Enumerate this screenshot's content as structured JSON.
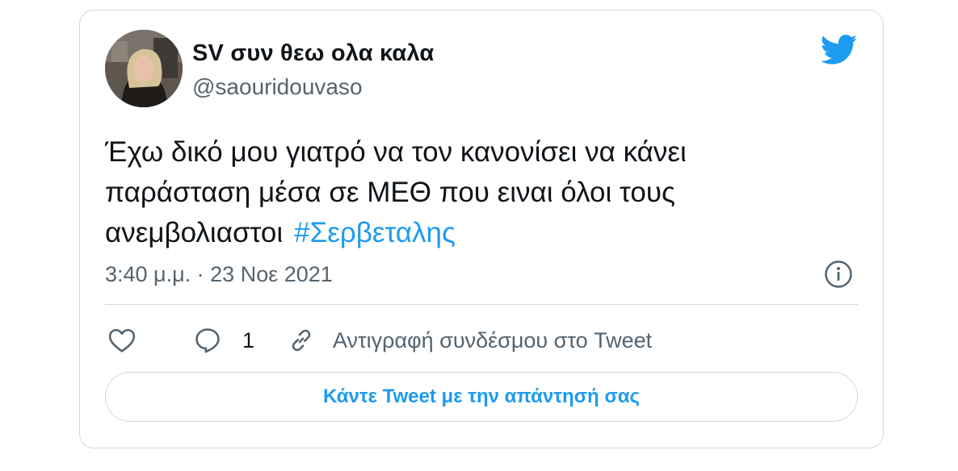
{
  "author": {
    "display_name": "SV συν θεω ολα καλα",
    "handle": "@saouridouvaso"
  },
  "tweet": {
    "line1": "Έχω δικό μου γιατρό να τον κανονίσει να κάνει",
    "line2": "παράσταση μέσα σε ΜΕΘ που ειναι όλοι τους",
    "line3": "ανεμβολιαστοι",
    "hashtag": "#Σερβεταλης",
    "timestamp": "3:40 μ.μ. · 23 Νοε 2021"
  },
  "actions": {
    "reply_count": "1",
    "copy_link_label": "Αντιγραφή συνδέσμου στο Tweet"
  },
  "reply_button": {
    "label": "Κάντε Tweet με την απάντησή σας"
  },
  "colors": {
    "accent": "#1d9bf0",
    "text": "#0f1419",
    "secondary": "#536471",
    "border": "#cfd9de"
  },
  "icons": [
    "twitter-bird-icon",
    "info-icon",
    "heart-icon",
    "reply-bubble-icon",
    "link-icon"
  ]
}
